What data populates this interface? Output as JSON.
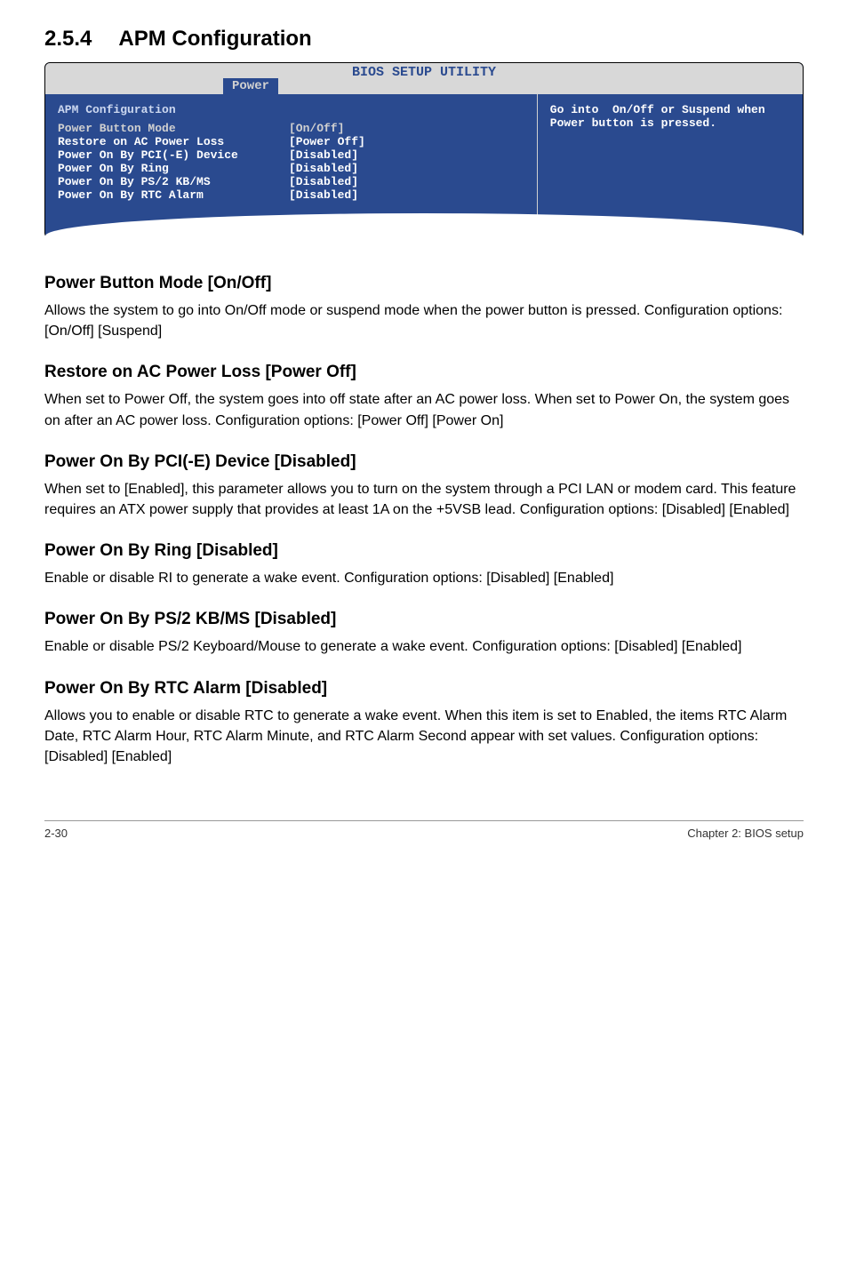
{
  "heading": {
    "num": "2.5.4",
    "title": "APM Configuration"
  },
  "bios": {
    "header_title": "BIOS SETUP UTILITY",
    "tab": "Power",
    "section_title": "APM Configuration",
    "rows": [
      {
        "label": "Power Button Mode",
        "value": "[On/Off]",
        "highlight": true
      },
      {
        "label": "Restore on AC Power Loss",
        "value": "[Power Off]",
        "highlight": false
      },
      {
        "label": "",
        "value": "",
        "highlight": false
      },
      {
        "label": "Power On By PCI(-E) Device",
        "value": "[Disabled]",
        "highlight": false
      },
      {
        "label": "Power On By Ring",
        "value": "[Disabled]",
        "highlight": false
      },
      {
        "label": "Power On By PS/2 KB/MS",
        "value": "[Disabled]",
        "highlight": false
      },
      {
        "label": "Power On By RTC Alarm",
        "value": "[Disabled]",
        "highlight": false
      }
    ],
    "help_text": "Go into  On/Off or Suspend when Power button is pressed."
  },
  "sections": [
    {
      "title": "Power Button Mode [On/Off]",
      "text": "Allows the system to go into On/Off mode or suspend mode when the power button is pressed. Configuration options: [On/Off] [Suspend]"
    },
    {
      "title": "Restore on AC Power Loss [Power Off]",
      "text": "When set to Power Off, the system goes into off state after an AC power loss. When set to Power On, the system goes on after an AC power loss. Configuration options: [Power Off] [Power On]"
    },
    {
      "title": "Power On By PCI(-E) Device [Disabled]",
      "text": "When set to [Enabled], this parameter allows you to turn on the system through a PCI LAN or modem card. This feature requires an ATX power supply that provides at least 1A on the +5VSB lead. Configuration options: [Disabled] [Enabled]"
    },
    {
      "title": "Power On By Ring [Disabled]",
      "text": "Enable or disable RI to generate a wake event. Configuration options: [Disabled] [Enabled]"
    },
    {
      "title": "Power On By PS/2 KB/MS [Disabled]",
      "text": "Enable or disable PS/2 Keyboard/Mouse to generate a wake event. Configuration options: [Disabled] [Enabled]"
    },
    {
      "title": "Power On By RTC Alarm [Disabled]",
      "text": "Allows you to enable or disable RTC to generate a wake event. When this item is set to Enabled, the items RTC Alarm Date, RTC Alarm Hour, RTC Alarm Minute, and RTC Alarm Second appear with set values. Configuration options: [Disabled] [Enabled]"
    }
  ],
  "footer": {
    "left": "2-30",
    "right": "Chapter 2: BIOS setup"
  }
}
